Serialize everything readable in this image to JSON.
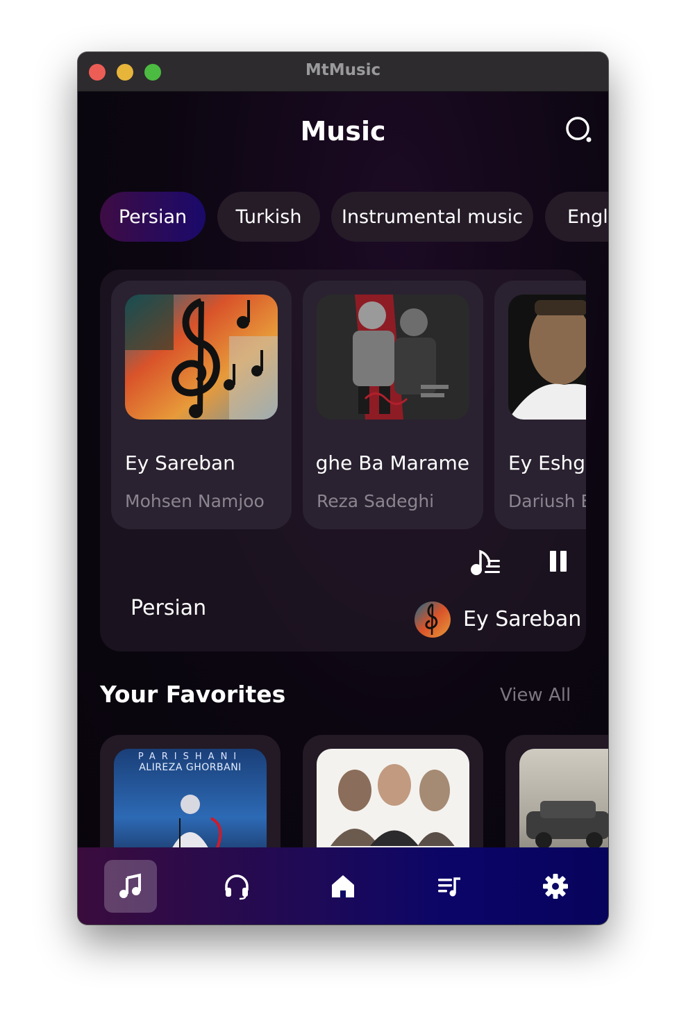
{
  "window": {
    "title": "MtMusic"
  },
  "header": {
    "title": "Music",
    "search_icon": "search-icon"
  },
  "categories": [
    {
      "label": "Persian",
      "active": true
    },
    {
      "label": "Turkish",
      "active": false
    },
    {
      "label": "Instrumental music",
      "active": false
    },
    {
      "label": "English",
      "active": false
    }
  ],
  "tracks": [
    {
      "title": "Ey Sareban",
      "artist": "Mohsen Namjoo"
    },
    {
      "title": "Rafighe Ba Marame",
      "artist": "Reza Sadeghi"
    },
    {
      "title": "Ey Eshgh",
      "artist": "Dariush Eghbali"
    }
  ],
  "player": {
    "category": "Persian",
    "now_playing": "Ey Sareban",
    "queue_icon": "music-queue-icon",
    "pause_icon": "pause-icon"
  },
  "favorites": {
    "heading": "Your Favorites",
    "view_all": "View All",
    "items": [
      {
        "art_text_top": "PARISHANI",
        "art_text_sub": "ALIREZA GHORBANI"
      },
      {
        "art_text_top": "",
        "art_text_sub": ""
      },
      {
        "art_text_top": "",
        "art_text_sub": ""
      }
    ]
  },
  "nav": [
    {
      "icon": "music-note-icon",
      "active": true
    },
    {
      "icon": "headphones-icon",
      "active": false
    },
    {
      "icon": "home-icon",
      "active": false
    },
    {
      "icon": "playlist-icon",
      "active": false
    },
    {
      "icon": "settings-icon",
      "active": false
    }
  ],
  "colors": {
    "accent_start": "#3e0c44",
    "accent_end": "#1a0a6b",
    "nav_start": "#3a0c3d",
    "nav_end": "#07045c"
  }
}
